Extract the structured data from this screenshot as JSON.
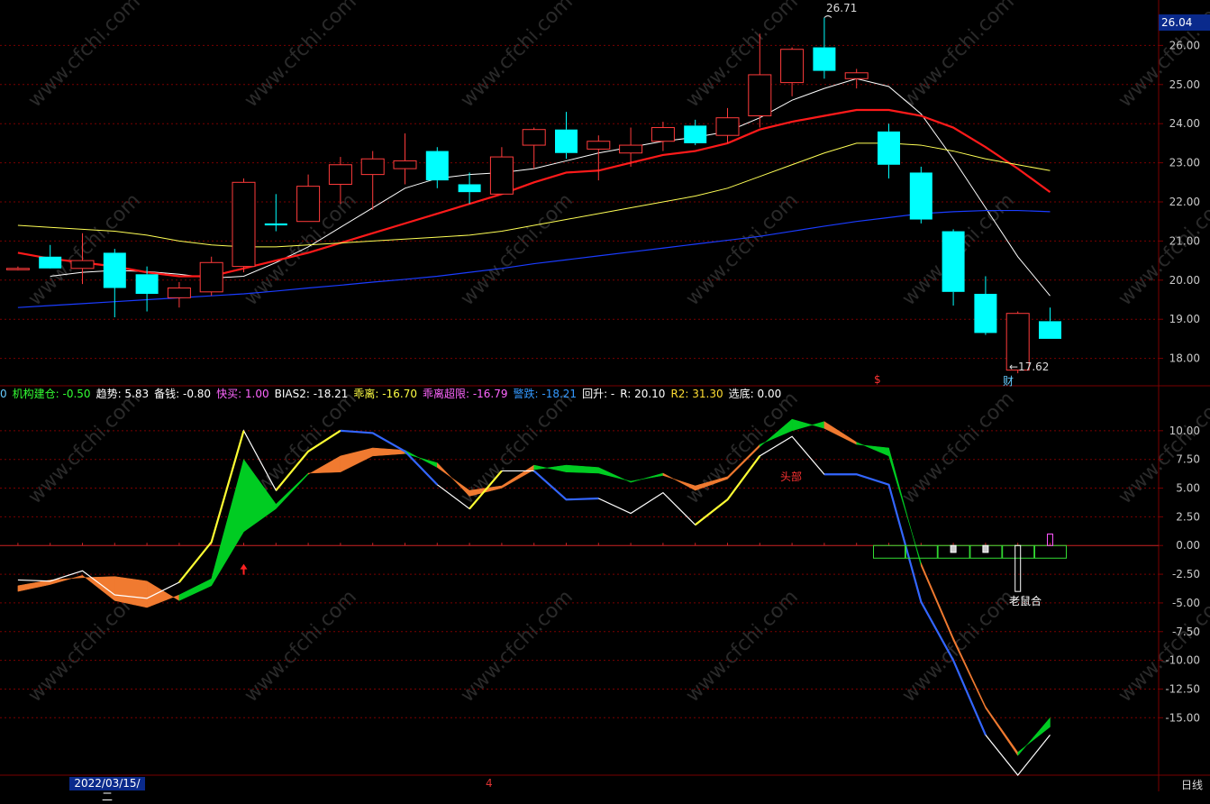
{
  "colors": {
    "up": "#ff3b3b",
    "down": "#00ffff",
    "ma5": "#ffffff",
    "ma10": "#ff1a1a",
    "ma20": "#ffff55",
    "ma60": "#1a3cff",
    "grid": "#7a0000",
    "fill_up": "#f07a30",
    "fill_down": "#00cc22"
  },
  "price_badge": "26.04",
  "annotations": {
    "high": "26.71",
    "low": "←17.62",
    "s_marker": "$",
    "cai_marker": "财",
    "head_label": "头部",
    "mouse_label": "老鼠合"
  },
  "indicator_bar": [
    {
      "text": "0",
      "color": "#66ccff"
    },
    {
      "text": "机构建仓: -0.50",
      "color": "#33ff33"
    },
    {
      "text": "趋势: 5.83",
      "color": "#ffffff"
    },
    {
      "text": "备钱: -0.80",
      "color": "#ffffff"
    },
    {
      "text": "快买: 1.00",
      "color": "#ff66ff"
    },
    {
      "text": "BIAS2: -18.21",
      "color": "#ffffff"
    },
    {
      "text": "乖离: -16.70",
      "color": "#ffff44"
    },
    {
      "text": "乖离超限: -16.79",
      "color": "#ff66ff"
    },
    {
      "text": "警跌: -18.21",
      "color": "#3399ff"
    },
    {
      "text": "回升: -",
      "color": "#ffffff"
    },
    {
      "text": "R: 20.10",
      "color": "#ffffff"
    },
    {
      "text": "R2: 31.30",
      "color": "#ffdd33"
    },
    {
      "text": "选底: 0.00",
      "color": "#ffffff"
    }
  ],
  "footer": {
    "date": "2022/03/15/二",
    "mid_marker": "4",
    "period": "日线"
  },
  "chart_data": [
    {
      "type": "candlestick",
      "title": "",
      "ylim": [
        17.3,
        26.7
      ],
      "y_ticks": [
        18.0,
        19.0,
        20.0,
        21.0,
        22.0,
        23.0,
        24.0,
        25.0,
        26.0
      ],
      "y_tick_labels": [
        "18.00",
        "19.00",
        "20.00",
        "21.00",
        "22.00",
        "23.00",
        "24.00",
        "25.00",
        "26.00"
      ],
      "candles": [
        {
          "o": 20.3,
          "h": 20.35,
          "l": 20.25,
          "c": 20.3
        },
        {
          "o": 20.6,
          "h": 20.9,
          "l": 20.35,
          "c": 20.3
        },
        {
          "o": 20.3,
          "h": 21.2,
          "l": 19.9,
          "c": 20.5
        },
        {
          "o": 20.7,
          "h": 20.8,
          "l": 19.05,
          "c": 19.8
        },
        {
          "o": 20.15,
          "h": 20.35,
          "l": 19.2,
          "c": 19.65
        },
        {
          "o": 19.55,
          "h": 19.95,
          "l": 19.3,
          "c": 19.8
        },
        {
          "o": 19.7,
          "h": 20.6,
          "l": 19.6,
          "c": 20.45
        },
        {
          "o": 20.35,
          "h": 22.6,
          "l": 20.2,
          "c": 22.5
        },
        {
          "o": 21.45,
          "h": 22.2,
          "l": 21.25,
          "c": 21.4
        },
        {
          "o": 21.5,
          "h": 22.7,
          "l": 21.5,
          "c": 22.4
        },
        {
          "o": 22.45,
          "h": 23.15,
          "l": 21.95,
          "c": 22.95
        },
        {
          "o": 22.7,
          "h": 23.3,
          "l": 21.8,
          "c": 23.1
        },
        {
          "o": 22.85,
          "h": 23.75,
          "l": 22.45,
          "c": 23.05
        },
        {
          "o": 23.3,
          "h": 23.4,
          "l": 22.35,
          "c": 22.55
        },
        {
          "o": 22.45,
          "h": 22.75,
          "l": 21.95,
          "c": 22.25
        },
        {
          "o": 22.2,
          "h": 23.4,
          "l": 22.2,
          "c": 23.15
        },
        {
          "o": 23.45,
          "h": 23.9,
          "l": 22.85,
          "c": 23.85
        },
        {
          "o": 23.85,
          "h": 24.3,
          "l": 23.1,
          "c": 23.25
        },
        {
          "o": 23.35,
          "h": 23.7,
          "l": 22.55,
          "c": 23.55
        },
        {
          "o": 23.25,
          "h": 23.9,
          "l": 22.9,
          "c": 23.45
        },
        {
          "o": 23.55,
          "h": 24.05,
          "l": 23.3,
          "c": 23.9
        },
        {
          "o": 23.95,
          "h": 24.1,
          "l": 23.45,
          "c": 23.5
        },
        {
          "o": 23.7,
          "h": 24.4,
          "l": 23.5,
          "c": 24.15
        },
        {
          "o": 24.2,
          "h": 26.3,
          "l": 23.9,
          "c": 25.25
        },
        {
          "o": 25.05,
          "h": 25.95,
          "l": 24.7,
          "c": 25.9
        },
        {
          "o": 25.95,
          "h": 26.71,
          "l": 25.15,
          "c": 25.35
        },
        {
          "o": 25.15,
          "h": 25.4,
          "l": 24.9,
          "c": 25.3
        },
        {
          "o": 23.8,
          "h": 24.0,
          "l": 22.6,
          "c": 22.95
        },
        {
          "o": 22.75,
          "h": 22.9,
          "l": 21.45,
          "c": 21.55
        },
        {
          "o": 21.25,
          "h": 21.3,
          "l": 19.35,
          "c": 19.7
        },
        {
          "o": 19.65,
          "h": 20.1,
          "l": 18.6,
          "c": 18.65
        },
        {
          "o": 17.7,
          "h": 19.2,
          "l": 17.62,
          "c": 19.15
        },
        {
          "o": 18.95,
          "h": 19.3,
          "l": 18.5,
          "c": 18.5
        }
      ],
      "ma_series": [
        {
          "values": [
            null,
            20.1,
            20.2,
            20.25,
            20.22,
            20.15,
            20.05,
            20.1,
            20.45,
            20.85,
            21.35,
            21.85,
            22.35,
            22.6,
            22.7,
            22.75,
            22.85,
            23.05,
            23.25,
            23.4,
            23.55,
            23.65,
            23.8,
            24.15,
            24.6,
            24.9,
            25.15,
            24.95,
            24.25,
            23.1,
            21.85,
            20.6,
            19.6
          ]
        },
        {
          "values": [
            20.7,
            20.55,
            20.45,
            20.35,
            20.2,
            20.1,
            20.1,
            20.3,
            20.5,
            20.7,
            20.95,
            21.2,
            21.45,
            21.7,
            21.95,
            22.2,
            22.5,
            22.75,
            22.8,
            23.0,
            23.2,
            23.3,
            23.5,
            23.85,
            24.05,
            24.2,
            24.35,
            24.35,
            24.2,
            23.9,
            23.4,
            22.85,
            22.25
          ]
        },
        {
          "values": [
            21.4,
            21.35,
            21.3,
            21.25,
            21.15,
            21.0,
            20.9,
            20.85,
            20.85,
            20.9,
            20.95,
            21.0,
            21.05,
            21.1,
            21.15,
            21.25,
            21.4,
            21.55,
            21.7,
            21.85,
            22.0,
            22.15,
            22.35,
            22.65,
            22.95,
            23.25,
            23.5,
            23.5,
            23.45,
            23.3,
            23.1,
            22.95,
            22.8
          ]
        },
        {
          "values": [
            19.3,
            19.35,
            19.4,
            19.45,
            19.5,
            19.55,
            19.6,
            19.65,
            19.72,
            19.8,
            19.87,
            19.95,
            20.02,
            20.1,
            20.2,
            20.3,
            20.42,
            20.52,
            20.62,
            20.72,
            20.82,
            20.92,
            21.02,
            21.12,
            21.25,
            21.38,
            21.5,
            21.6,
            21.7,
            21.75,
            21.78,
            21.78,
            21.75
          ]
        }
      ]
    },
    {
      "type": "line",
      "title": "",
      "ylim": [
        -20.0,
        12.5
      ],
      "y_ticks": [
        10,
        7.5,
        5,
        2.5,
        0,
        -2.5,
        -5,
        -7.5,
        -10,
        -12.5,
        -15
      ],
      "y_tick_labels": [
        "10.00",
        "7.50",
        "5.00",
        "2.50",
        "0.00",
        "-2.50",
        "-5.00",
        "-7.50",
        "-10.00",
        "-12.50",
        "-15.00"
      ],
      "series": [
        {
          "values": [
            -3.0,
            -3.1,
            -2.2,
            -4.3,
            -4.6,
            -3.2,
            0.3,
            10.0,
            4.8,
            8.2,
            10.0,
            9.8,
            8.2,
            5.3,
            3.2,
            6.5,
            6.5,
            4.0,
            4.1,
            2.8,
            4.6,
            1.8,
            4.0,
            7.8,
            9.5,
            6.2,
            6.2,
            5.3,
            -4.9,
            -10.0,
            -16.5,
            -20.0,
            -16.5
          ]
        },
        {
          "values": [
            -3.5,
            -3.0,
            -2.8,
            -2.7,
            -3.1,
            -4.8,
            -3.5,
            1.2,
            3.2,
            6.2,
            7.8,
            8.5,
            8.3,
            6.8,
            4.8,
            5.2,
            7.0,
            6.4,
            6.3,
            5.6,
            6.1,
            5.2,
            6.0,
            8.8,
            10.0,
            10.8,
            9.0,
            7.8,
            -1.5,
            -8.0,
            -14.0,
            -18.0,
            -15.8
          ]
        },
        {
          "values": [
            -3.5,
            -3.0,
            -2.8,
            -2.7,
            -3.1,
            -4.8,
            -3.5,
            1.2,
            3.2,
            6.2,
            7.8,
            8.5,
            8.3,
            6.8,
            4.8,
            5.2,
            7.0,
            6.4,
            6.3,
            5.6,
            6.1,
            5.2,
            6.0,
            8.8,
            10.0,
            10.8,
            9.0,
            7.8,
            -1.5,
            -8.0,
            -14.0,
            -18.0,
            -15.8
          ]
        },
        {
          "values": [
            -4.0,
            -3.4,
            -2.6,
            -4.8,
            -5.4,
            -4.3,
            -2.9,
            7.5,
            3.6,
            6.3,
            6.4,
            7.8,
            8.0,
            7.2,
            4.3,
            5.0,
            6.6,
            7.0,
            6.8,
            5.5,
            6.3,
            4.8,
            5.8,
            8.6,
            11.0,
            10.2,
            8.8,
            8.5,
            -1.8,
            -8.3,
            -14.2,
            -18.3,
            -15.0
          ]
        }
      ],
      "histogram": [
        {
          "x_index": 29,
          "value": -0.6
        },
        {
          "x_index": 30,
          "value": -0.6
        },
        {
          "x_index": 31,
          "value": -4.0
        },
        {
          "x_index": 32,
          "value": 1.0
        }
      ]
    }
  ]
}
